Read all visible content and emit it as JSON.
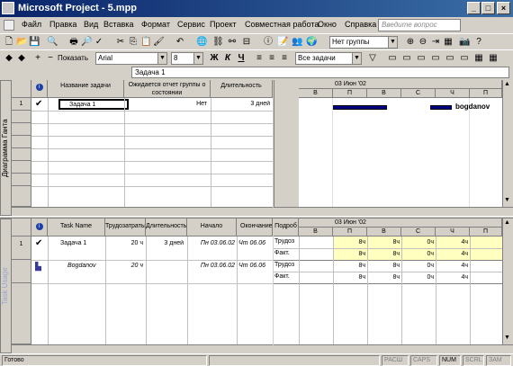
{
  "window": {
    "title": "Microsoft Project - 5.mpp"
  },
  "menu": {
    "items": [
      "Файл",
      "Правка",
      "Вид",
      "Вставка",
      "Формат",
      "Сервис",
      "Проект",
      "Совместная работа",
      "Окно",
      "Справка"
    ],
    "help_placeholder": "Введите вопрос"
  },
  "toolbar1": {
    "group_combo": "Нет группы"
  },
  "toolbar2": {
    "show_label": "Показать",
    "font": "Arial",
    "size": "8",
    "bold": "Ж",
    "italic": "К",
    "underline": "Ч",
    "filter": "Все задачи"
  },
  "editbar": {
    "value": "Задача 1"
  },
  "gantt": {
    "side_label": "Диаграмма Ганта",
    "columns": [
      "Название задачи",
      "Ожидается отчет группы о состоянии",
      "Длительность"
    ],
    "row": {
      "num": "1",
      "name": "Задача 1",
      "status": "Нет",
      "duration": "3 дней"
    },
    "week_label": "03 Июн '02",
    "days": [
      "В",
      "П",
      "В",
      "С",
      "Ч",
      "П"
    ],
    "resource_label": "bogdanov"
  },
  "usage": {
    "side_label": "Task Usage",
    "columns": [
      "Task Name",
      "Трудозатраты",
      "Длительность",
      "Начало",
      "Окончание"
    ],
    "rows": [
      {
        "num": "1",
        "name": "Задача 1",
        "work": "20 ч",
        "duration": "3 дней",
        "start": "Пн 03.06.02",
        "finish": "Чт 06.06"
      },
      {
        "num": "",
        "name": "Bogdanov",
        "work": "20 ч",
        "duration": "",
        "start": "Пн 03.06.02",
        "finish": "Чт 06.06"
      }
    ],
    "details_header": "Подроб",
    "week_label": "03 Июн '02",
    "days": [
      "В",
      "П",
      "В",
      "С",
      "Ч",
      "П"
    ],
    "detail_rows": [
      {
        "label": "Трудоз",
        "values": [
          "",
          "8ч",
          "8ч",
          "0ч",
          "4ч",
          ""
        ]
      },
      {
        "label": "Факт.",
        "values": [
          "",
          "8ч",
          "8ч",
          "0ч",
          "4ч",
          ""
        ]
      },
      {
        "label": "Трудоз",
        "values": [
          "",
          "8ч",
          "8ч",
          "0ч",
          "4ч",
          ""
        ]
      },
      {
        "label": "Факт.",
        "values": [
          "",
          "8ч",
          "8ч",
          "0ч",
          "4ч",
          ""
        ]
      }
    ]
  },
  "status": {
    "ready": "Готово",
    "indicators": [
      "РАСШ",
      "CAPS",
      "NUM",
      "SCRL",
      "ЗАМ"
    ]
  }
}
